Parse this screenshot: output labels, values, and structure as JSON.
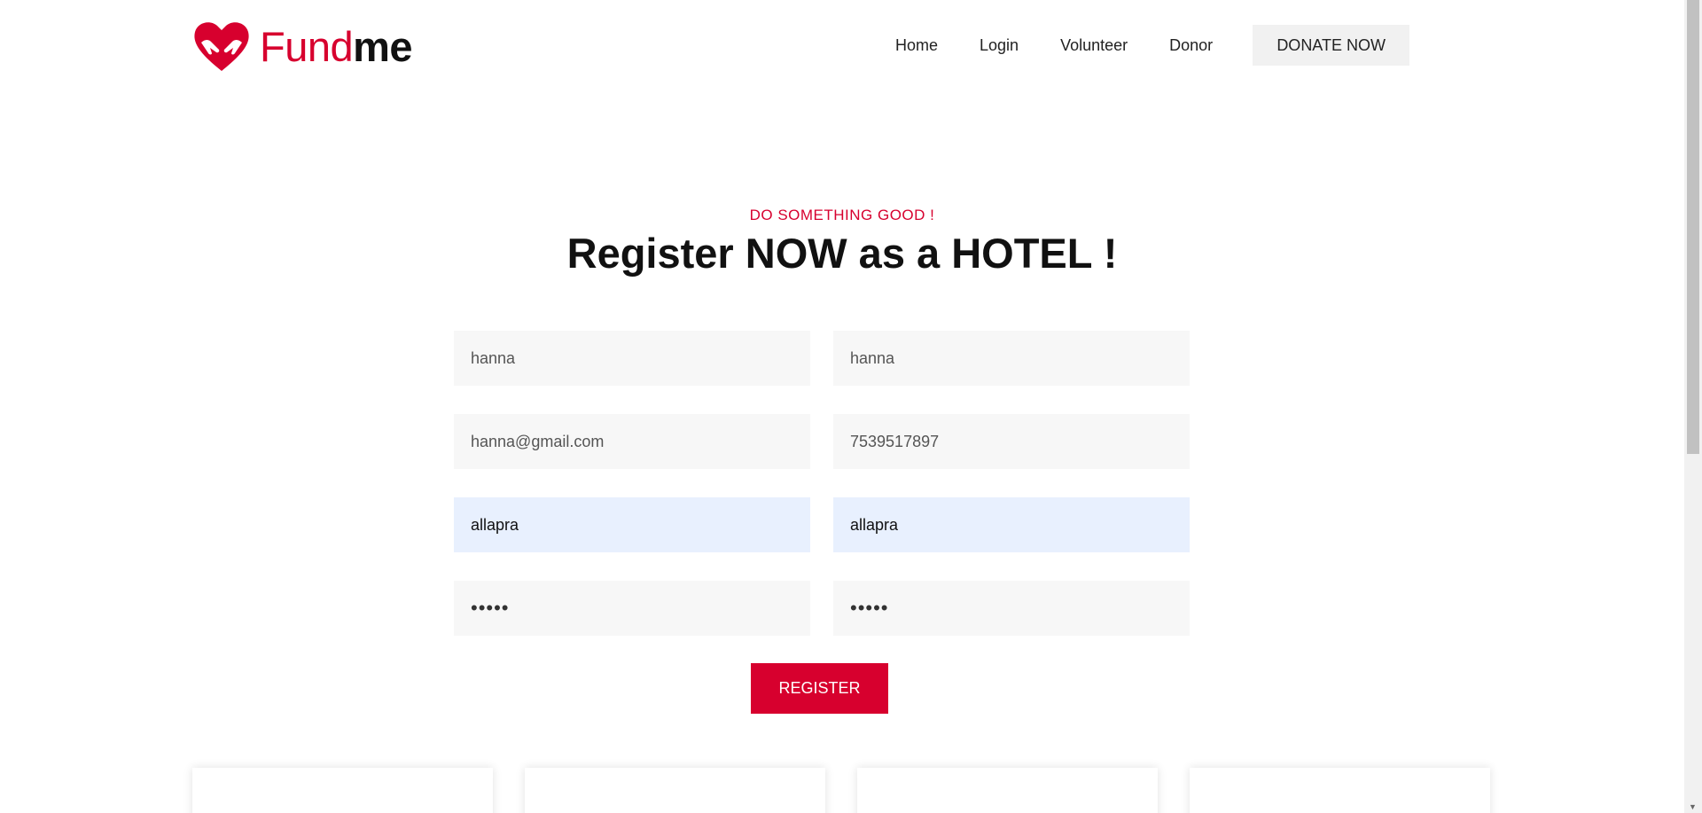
{
  "header": {
    "logo": {
      "part1": "Fund",
      "part2": "me",
      "icon": "heart-hands-icon"
    },
    "nav": {
      "home": "Home",
      "login": "Login",
      "volunteer": "Volunteer",
      "donor": "Donor",
      "donate": "DONATE NOW"
    }
  },
  "section": {
    "subtitle": "DO SOMETHING GOOD !",
    "title": "Register NOW as a HOTEL !"
  },
  "form": {
    "field1": "hanna",
    "field2": "hanna",
    "email": "hanna@gmail.com",
    "phone": "7539517897",
    "field5": "allapra",
    "field6": "allapra",
    "password": "•••••",
    "confirm_password": "•••••",
    "submit": "REGISTER"
  },
  "colors": {
    "brand": "#d7002e",
    "field_bg": "#f7f7f7",
    "autofill_bg": "#e8f0fe"
  }
}
